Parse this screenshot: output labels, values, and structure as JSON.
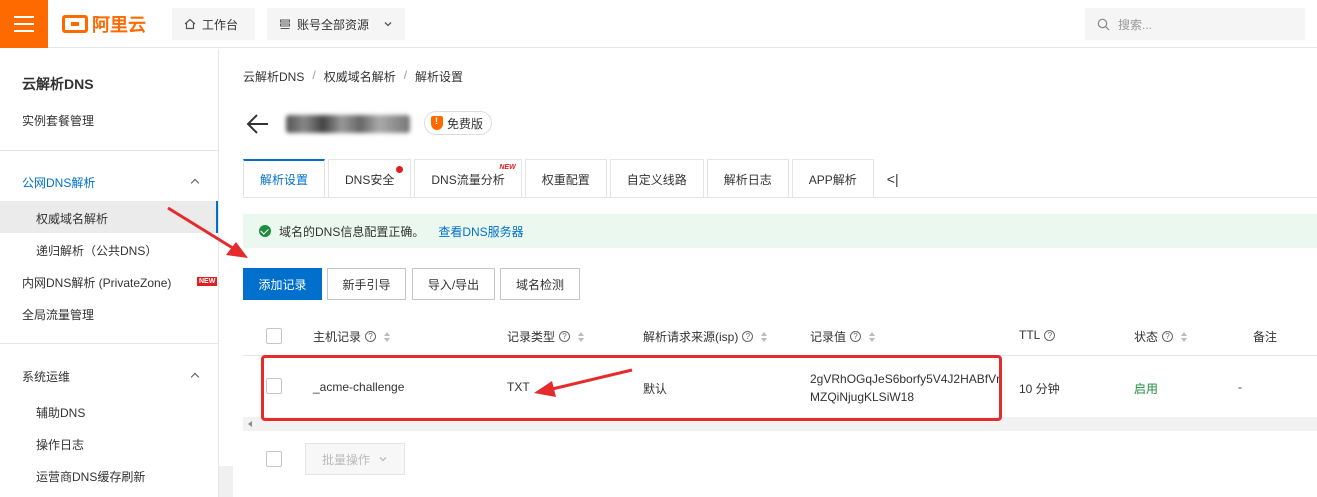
{
  "topbar": {
    "logo_text": "阿里云",
    "workbench_label": "工作台",
    "resource_label": "账号全部资源",
    "search_placeholder": "搜索..."
  },
  "sidebar": {
    "title": "云解析DNS",
    "instance_label": "实例套餐管理",
    "public_group": "公网DNS解析",
    "authoritative": "权威域名解析",
    "recursive": "递归解析（公共DNS）",
    "private_zone": "内网DNS解析 (PrivateZone)",
    "private_zone_badge": "NEW",
    "global_traffic": "全局流量管理",
    "ops_group": "系统运维",
    "assist_dns": "辅助DNS",
    "op_log": "操作日志",
    "carrier_refresh": "运营商DNS缓存刷新"
  },
  "breadcrumb": {
    "items": [
      "云解析DNS",
      "权威域名解析",
      "解析设置"
    ],
    "separator": "/"
  },
  "header": {
    "plan_badge": "免费版"
  },
  "tabs": {
    "items": [
      "解析设置",
      "DNS安全",
      "DNS流量分析",
      "权重配置",
      "自定义线路",
      "解析日志",
      "APP解析"
    ],
    "new_badge": "NEW",
    "more": "<|"
  },
  "alert": {
    "message": "域名的DNS信息配置正确。",
    "link": "查看DNS服务器"
  },
  "actions": {
    "add_record": "添加记录",
    "guide": "新手引导",
    "import_export": "导入/导出",
    "domain_check": "域名检测"
  },
  "table": {
    "headers": {
      "host": "主机记录",
      "type": "记录类型",
      "isp": "解析请求来源(isp)",
      "value": "记录值",
      "ttl": "TTL",
      "status": "状态",
      "remark": "备注"
    },
    "rows": [
      {
        "host": "_acme-challenge",
        "type": "TXT",
        "isp": "默认",
        "value_line1": "2gVRhOGqJeS6borfy5V4J2HABfVn",
        "value_line2": "MZQiNjugKLSiW18",
        "ttl": "10 分钟",
        "status": "启用",
        "remark": "-"
      }
    ],
    "batch_label": "批量操作"
  },
  "colors": {
    "brand": "#ff6a00",
    "primary": "#0070cc",
    "success": "#1e8e3e",
    "annotation": "#e52b2b"
  }
}
